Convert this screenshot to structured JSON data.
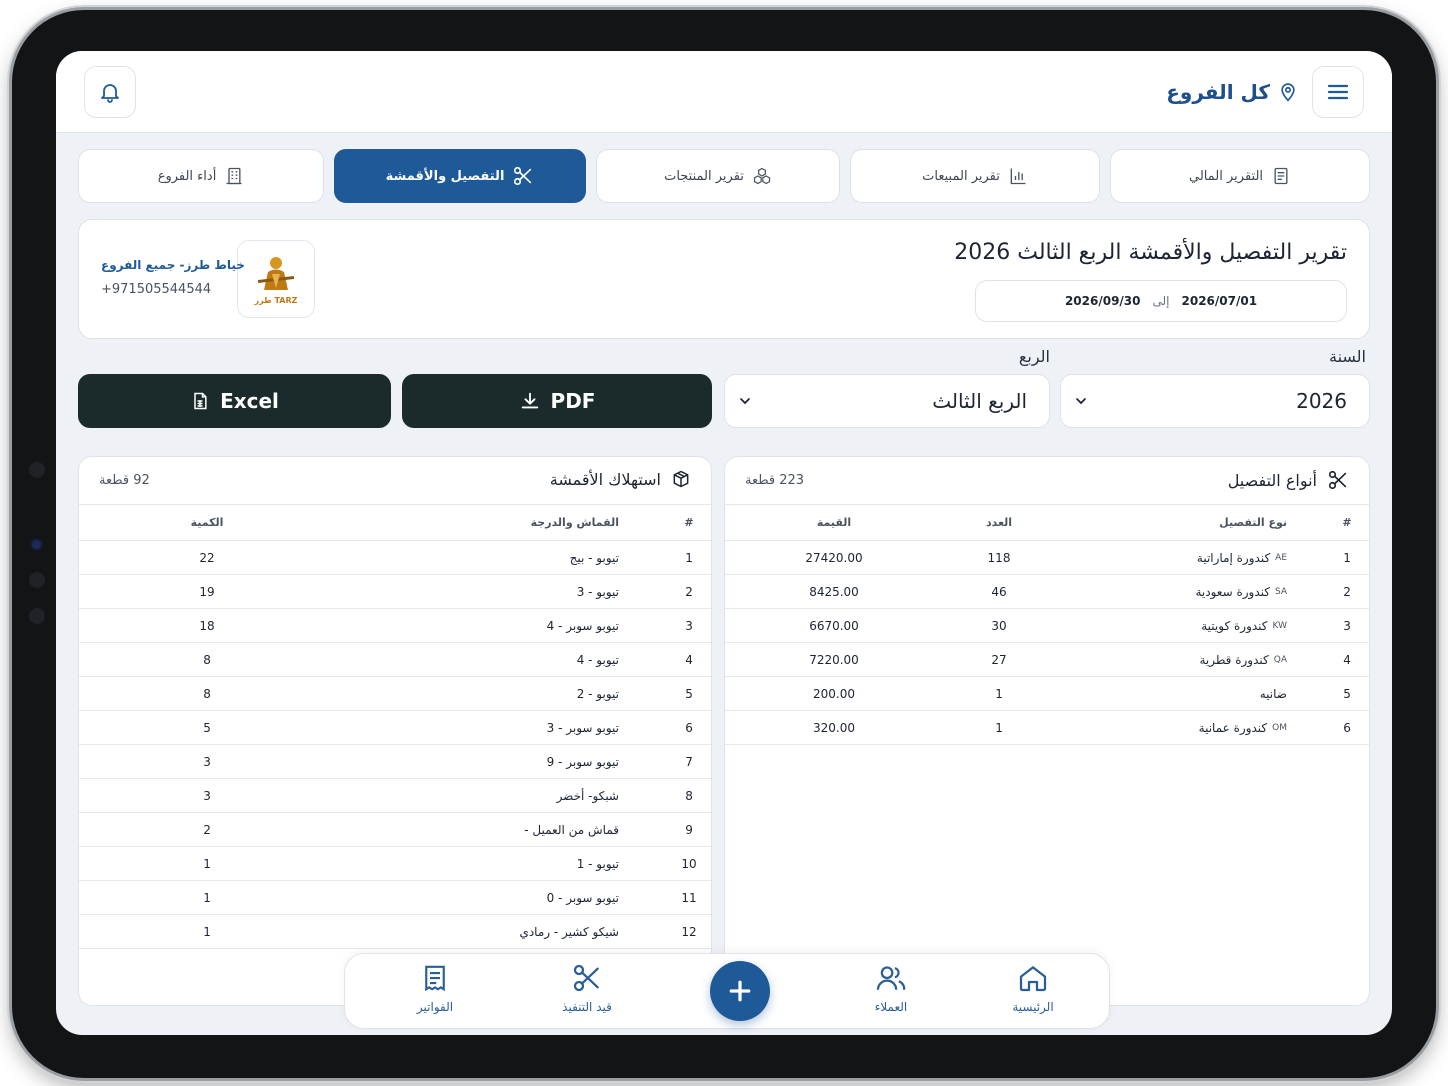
{
  "header": {
    "branch_title": "كل الفروع",
    "icons": {
      "menu": "menu-icon",
      "location": "map-pin-icon",
      "notification": "bell-icon"
    }
  },
  "tabs": [
    {
      "label": "التقرير المالي",
      "icon": "document-icon",
      "active": false
    },
    {
      "label": "تقرير المبيعات",
      "icon": "bar-chart-icon",
      "active": false
    },
    {
      "label": "تقرير المنتجات",
      "icon": "boxes-icon",
      "active": false
    },
    {
      "label": "التفصيل والأقمشة",
      "icon": "scissors-icon",
      "active": true
    },
    {
      "label": "أداء الفروع",
      "icon": "building-icon",
      "active": false
    }
  ],
  "report": {
    "title": "تقرير التفصيل والأقمشة الربع الثالث 2026",
    "date_from": "2026/07/01",
    "date_to_label": "إلى",
    "date_to": "2026/09/30",
    "shop_name": "خياط طرز- جميع الفروع",
    "shop_phone": "+971505544544",
    "logo_text": "TARZ طرز"
  },
  "filters": {
    "year_label": "السنة",
    "year_value": "2026",
    "quarter_label": "الربع",
    "quarter_value": "الربع الثالث"
  },
  "buttons": {
    "pdf": "PDF",
    "excel": "Excel"
  },
  "tailoring": {
    "title": "أنواع التفصيل",
    "count": "223 قطعة",
    "columns": {
      "index": "#",
      "type": "نوع التفصيل",
      "qty": "العدد",
      "value": "القيمة"
    },
    "rows": [
      {
        "n": "1",
        "code": "AE",
        "name": "كندورة إماراتية",
        "qty": "118",
        "value": "27420.00"
      },
      {
        "n": "2",
        "code": "SA",
        "name": "كندورة سعودية",
        "qty": "46",
        "value": "8425.00"
      },
      {
        "n": "3",
        "code": "KW",
        "name": "كندورة كويتية",
        "qty": "30",
        "value": "6670.00"
      },
      {
        "n": "4",
        "code": "QA",
        "name": "كندورة قطرية",
        "qty": "27",
        "value": "7220.00"
      },
      {
        "n": "5",
        "code": "",
        "name": "ضانيه",
        "qty": "1",
        "value": "200.00"
      },
      {
        "n": "6",
        "code": "OM",
        "name": "كندورة عمانية",
        "qty": "1",
        "value": "320.00"
      }
    ]
  },
  "fabrics": {
    "title": "استهلاك الأقمشة",
    "count": "92 قطعة",
    "columns": {
      "index": "#",
      "fabric": "القماش والدرجة",
      "qty": "الكمية"
    },
    "rows": [
      {
        "n": "1",
        "fabric": "تيوبو - بيج",
        "qty": "22"
      },
      {
        "n": "2",
        "fabric": "تيوبو - 3",
        "qty": "19"
      },
      {
        "n": "3",
        "fabric": "تيوبو سوبر - 4",
        "qty": "18"
      },
      {
        "n": "4",
        "fabric": "تيوبو - 4",
        "qty": "8"
      },
      {
        "n": "5",
        "fabric": "تيوبو - 2",
        "qty": "8"
      },
      {
        "n": "6",
        "fabric": "تيوبو سوبر - 3",
        "qty": "5"
      },
      {
        "n": "7",
        "fabric": "تيوبو سوبر - 9",
        "qty": "3"
      },
      {
        "n": "8",
        "fabric": "شبكو- أخضر",
        "qty": "3"
      },
      {
        "n": "9",
        "fabric": "قماش من العميل -",
        "qty": "2"
      },
      {
        "n": "10",
        "fabric": "تيوبو - 1",
        "qty": "1"
      },
      {
        "n": "11",
        "fabric": "تيوبو سوبر - 0",
        "qty": "1"
      },
      {
        "n": "12",
        "fabric": "شيكو كشير - رمادي",
        "qty": "1"
      }
    ]
  },
  "bottom_nav": [
    {
      "label": "الرئيسية",
      "icon": "home-icon"
    },
    {
      "label": "العملاء",
      "icon": "users-icon"
    },
    {
      "label": "",
      "icon": "plus-icon"
    },
    {
      "label": "قيد التنفيذ",
      "icon": "scissors-icon"
    },
    {
      "label": "الفواتير",
      "icon": "invoice-icon"
    }
  ],
  "colors": {
    "primary": "#1f5a98",
    "dark_button": "#1b2a2b",
    "screen_bg": "#eef1f6"
  }
}
